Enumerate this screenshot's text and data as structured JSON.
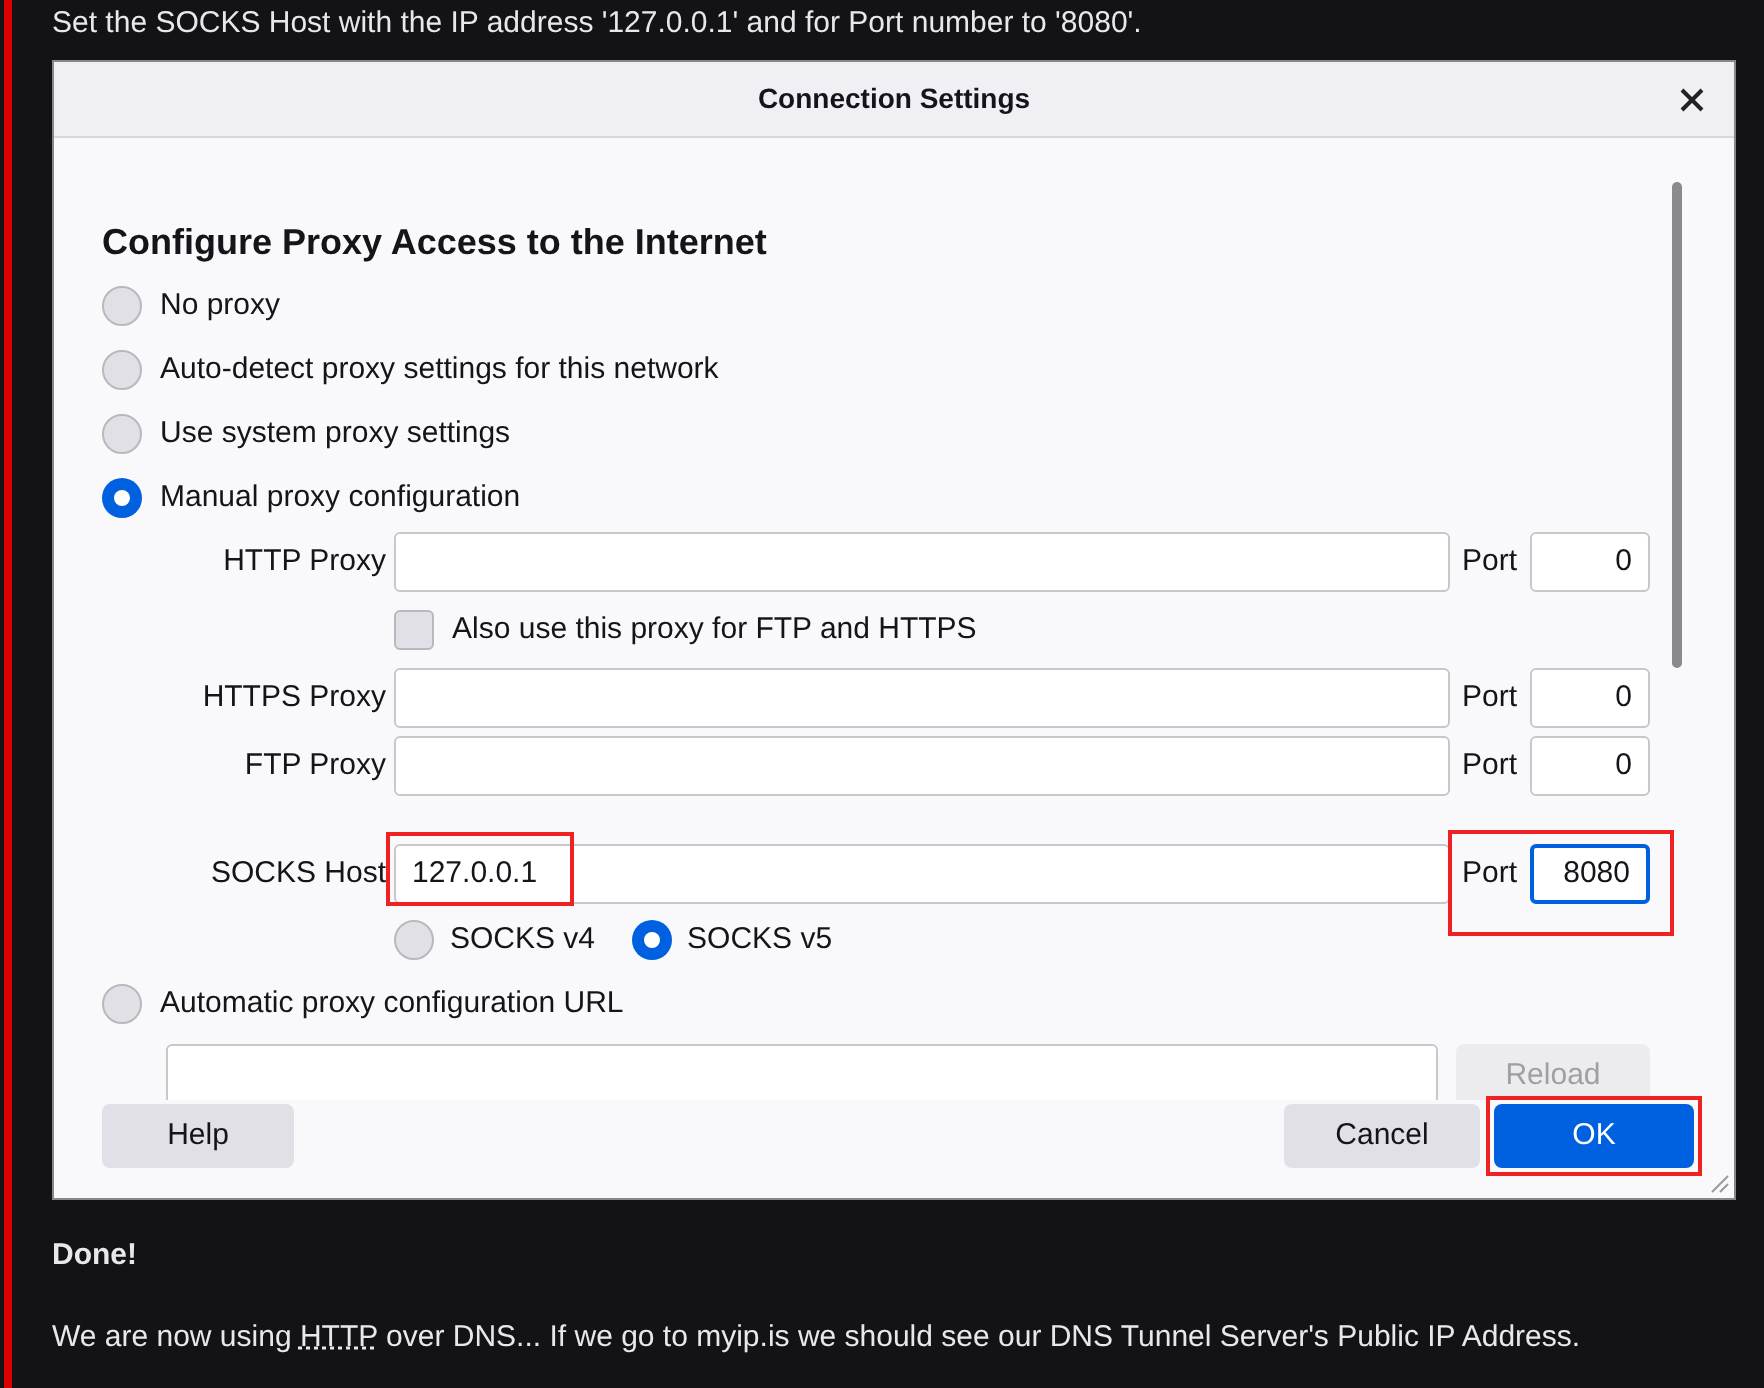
{
  "intro": "Set the SOCKS Host with the IP address '127.0.0.1' and for Port number to '8080'.",
  "dialog": {
    "title": "Connection Settings",
    "heading": "Configure Proxy Access to the Internet",
    "modes": [
      {
        "label": "No proxy",
        "selected": false
      },
      {
        "label": "Auto-detect proxy settings for this network",
        "selected": false
      },
      {
        "label": "Use system proxy settings",
        "selected": false
      },
      {
        "label": "Manual proxy configuration",
        "selected": true
      }
    ],
    "http": {
      "label": "HTTP Proxy",
      "port_label": "Port",
      "port": "0"
    },
    "also_use": {
      "label": "Also use this proxy for FTP and HTTPS",
      "checked": false
    },
    "proxies": [
      {
        "label": "HTTPS Proxy",
        "port_label": "Port",
        "port": "0"
      },
      {
        "label": "FTP Proxy",
        "port_label": "Port",
        "port": "0"
      }
    ],
    "socks": {
      "label": "SOCKS Host",
      "value": "127.0.0.1",
      "highlighted": true,
      "port_label": "Port",
      "port": "8080",
      "port_highlighted": true,
      "port_focused": true
    },
    "socks_versions": [
      {
        "label": "SOCKS v4",
        "selected": false
      },
      {
        "label": "SOCKS v5",
        "selected": true
      }
    ],
    "auto_url": {
      "label": "Automatic proxy configuration URL",
      "selected": false,
      "reload": "Reload",
      "reload_disabled": true
    },
    "buttons": [
      {
        "label": "Help",
        "kind": "help",
        "highlighted": false
      },
      {
        "label": "Cancel",
        "kind": "cancel",
        "highlighted": false
      },
      {
        "label": "OK",
        "kind": "primary",
        "highlighted": true
      }
    ]
  },
  "done": "Done!",
  "outro": [
    {
      "text": "We are now using ",
      "kind": "plain"
    },
    {
      "text": "HTTP",
      "kind": "abbr"
    },
    {
      "text": " over DNS... If we go to myip.is we should see our DNS Tunnel Server's Public IP Address.",
      "kind": "plain"
    }
  ]
}
